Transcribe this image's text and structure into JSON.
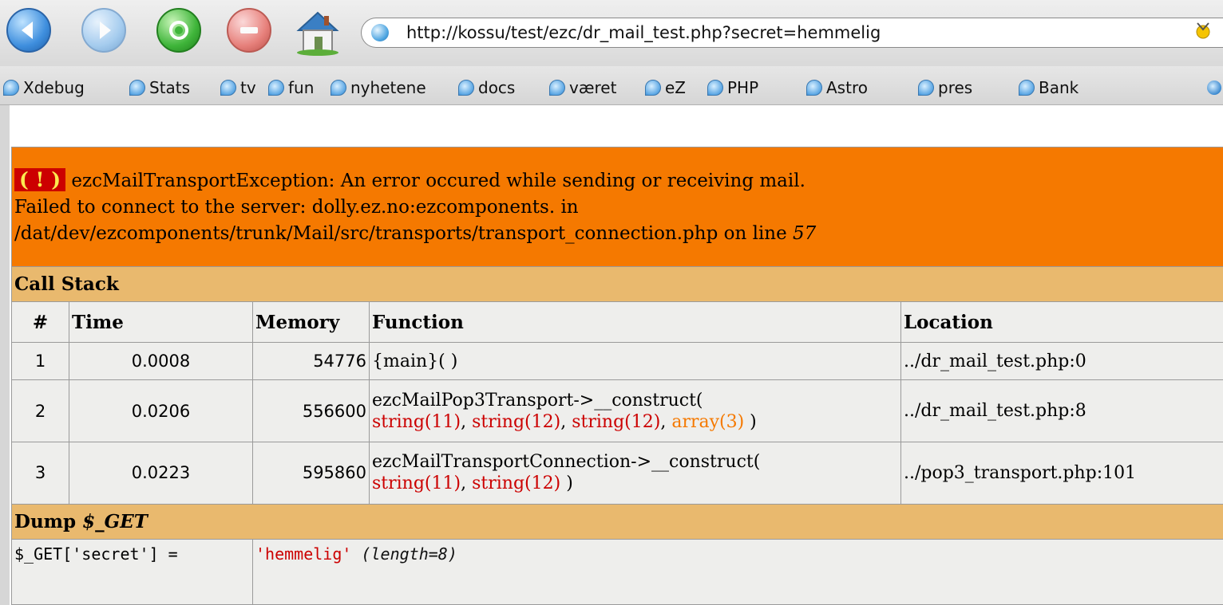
{
  "browser": {
    "url": "http://kossu/test/ezc/dr_mail_test.php?secret=hemmelig",
    "bookmarks": [
      "Xdebug",
      "Stats",
      "tv",
      "fun",
      "nyhetene",
      "docs",
      "været",
      "eZ",
      "PHP",
      "Astro",
      "pres",
      "Bank"
    ]
  },
  "error": {
    "marker": "( ! )",
    "line1": "ezcMailTransportException: An error occured while sending or receiving mail.",
    "line2": "Failed to connect to the server: dolly.ez.no:ezcomponents. in",
    "line3_path": "/dat/dev/ezcomponents/trunk/Mail/src/transports/transport_connection.php on line",
    "line3_number": "57"
  },
  "call_stack": {
    "title": "Call Stack",
    "headers": [
      "#",
      "Time",
      "Memory",
      "Function",
      "Location"
    ],
    "rows": [
      {
        "num": "1",
        "time": "0.0008",
        "memory": "54776",
        "func": "{main}( )",
        "args": [],
        "location": "../dr_mail_test.php:0"
      },
      {
        "num": "2",
        "time": "0.0206",
        "memory": "556600",
        "func": "ezcMailPop3Transport->__construct(",
        "args": [
          "string(11)",
          "string(12)",
          "string(12)",
          "array(3)"
        ],
        "close": " )",
        "location": "../dr_mail_test.php:8"
      },
      {
        "num": "3",
        "time": "0.0223",
        "memory": "595860",
        "func": "ezcMailTransportConnection->__construct(",
        "args": [
          "string(11)",
          "string(12)"
        ],
        "close": " )",
        "location": "../pop3_transport.php:101"
      }
    ]
  },
  "dump": {
    "title_prefix": "Dump",
    "title_var": "$_GET",
    "key": "$_GET['secret'] =",
    "value": "'hemmelig'",
    "length_open": "(",
    "length_label": "length",
    "length_eq": "=8)"
  },
  "colors": {
    "error_bg": "#f57900",
    "section_bg": "#e9b96e",
    "cell_bg": "#eeeeec",
    "string_red": "#cc0000",
    "array_orange": "#f57900"
  }
}
